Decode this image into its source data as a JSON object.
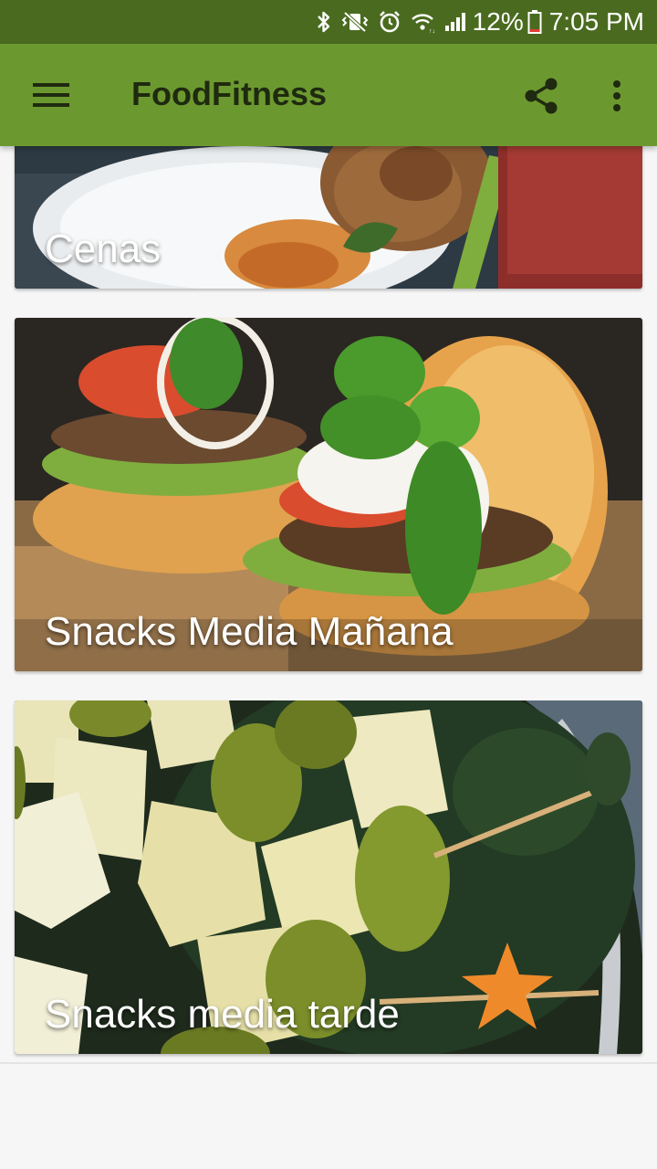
{
  "status_bar": {
    "battery": "12%",
    "time": "7:05 PM"
  },
  "app_bar": {
    "title": "FoodFitness"
  },
  "cards": [
    {
      "label": "Cenas"
    },
    {
      "label": "Snacks Media Mañana"
    },
    {
      "label": "Snacks media tarde"
    }
  ],
  "colors": {
    "status_bar": "#4a6b1f",
    "app_bar": "#6c992f",
    "title_text": "#1f2a10",
    "background": "#f6f6f6"
  },
  "icons": {
    "status": [
      "bluetooth-icon",
      "vibrate-icon",
      "alarm-icon",
      "wifi-icon",
      "signal-icon",
      "battery-icon"
    ],
    "app_bar": [
      "menu-icon",
      "share-icon",
      "more-vert-icon"
    ]
  }
}
